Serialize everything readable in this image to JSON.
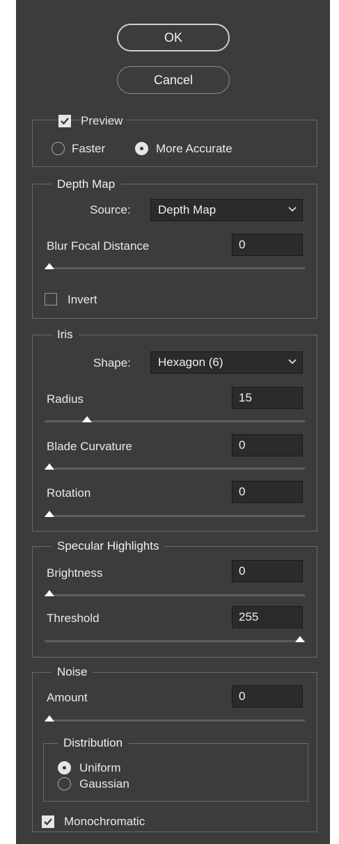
{
  "buttons": {
    "ok": "OK",
    "cancel": "Cancel"
  },
  "preview": {
    "label": "Preview",
    "checked": true,
    "options": [
      "Faster",
      "More Accurate"
    ],
    "selected": "More Accurate"
  },
  "depth_map": {
    "title": "Depth Map",
    "source_label": "Source:",
    "source_value": "Depth Map",
    "blur_label": "Blur Focal Distance",
    "blur_value": "0",
    "blur_slider_fraction": 0,
    "invert_label": "Invert",
    "invert_checked": false
  },
  "iris": {
    "title": "Iris",
    "shape_label": "Shape:",
    "shape_value": "Hexagon (6)",
    "radius_label": "Radius",
    "radius_value": "15",
    "radius_slider_fraction": 0.15,
    "blade_label": "Blade Curvature",
    "blade_value": "0",
    "blade_slider_fraction": 0,
    "rotation_label": "Rotation",
    "rotation_value": "0",
    "rotation_slider_fraction": 0
  },
  "specular": {
    "title": "Specular Highlights",
    "brightness_label": "Brightness",
    "brightness_value": "0",
    "brightness_slider_fraction": 0,
    "threshold_label": "Threshold",
    "threshold_value": "255",
    "threshold_slider_fraction": 1
  },
  "noise": {
    "title": "Noise",
    "amount_label": "Amount",
    "amount_value": "0",
    "amount_slider_fraction": 0,
    "distribution_title": "Distribution",
    "distribution_options": [
      "Uniform",
      "Gaussian"
    ],
    "distribution_selected": "Uniform",
    "mono_label": "Monochromatic",
    "mono_checked": true
  },
  "icons": {
    "checkmark": "check-icon",
    "dropdown": "chevron-down-icon"
  },
  "colors": {
    "panel_bg": "#3c3c3c",
    "field_bg": "#2b2b2b",
    "text": "#ececec",
    "group_border": "#6a6a6a"
  }
}
